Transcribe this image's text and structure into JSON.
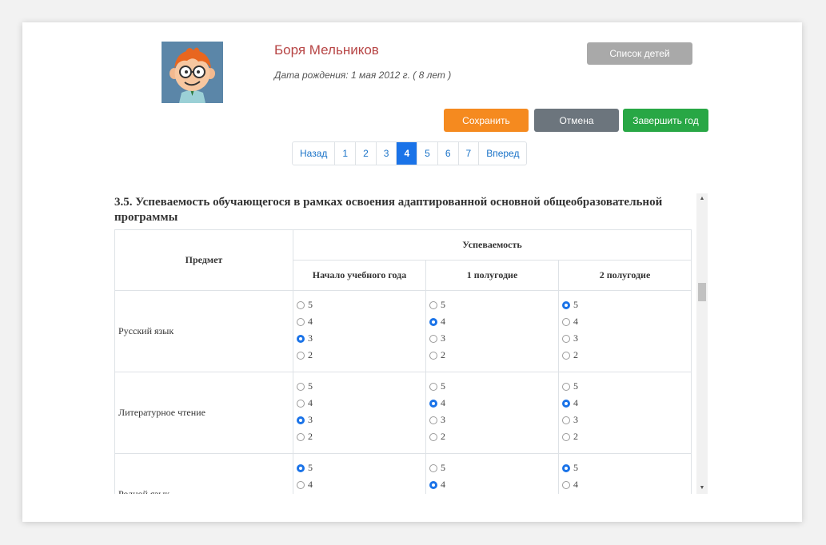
{
  "child": {
    "name": "Боря Мельников",
    "birth": "Дата рождения: 1 мая 2012 г. ( 8 лет )"
  },
  "buttons": {
    "children_list": "Список детей",
    "save": "Сохранить",
    "cancel": "Отмена",
    "finish_year": "Завершить год"
  },
  "pagination": [
    "Назад",
    "1",
    "2",
    "3",
    "4",
    "5",
    "6",
    "7",
    "Вперед"
  ],
  "pagination_active": "4",
  "section": {
    "title": "3.5. Успеваемость обучающегося в рамках освоения адаптированной основной общеобразовательной программы"
  },
  "table": {
    "subject_header": "Предмет",
    "progress_header": "Успеваемость",
    "periods": [
      "Начало учебного года",
      "1 полугодие",
      "2 полугодие"
    ],
    "grade_options": [
      "5",
      "4",
      "3",
      "2"
    ],
    "rows": [
      {
        "subject": "Русский язык",
        "selected": [
          "3",
          "4",
          "5"
        ]
      },
      {
        "subject": "Литературное чтение",
        "selected": [
          "3",
          "4",
          "4"
        ]
      },
      {
        "subject": "Родной язык",
        "selected": [
          "5",
          "4",
          "5"
        ]
      }
    ]
  },
  "colors": {
    "accent": "#1a73e8",
    "save": "#f58a1f",
    "cancel": "#6c757d",
    "finish": "#28a745",
    "name": "#b74545"
  },
  "icons": {
    "avatar": "cartoon-boy-avatar",
    "scroll_up": "triangle-up-icon",
    "scroll_down": "triangle-down-icon"
  }
}
